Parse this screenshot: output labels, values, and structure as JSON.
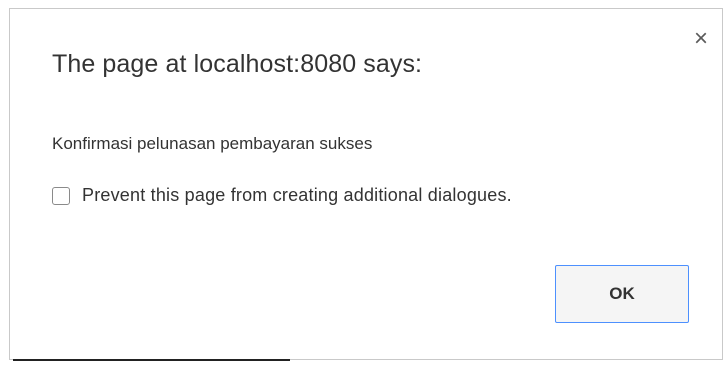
{
  "dialog": {
    "title": "The page at localhost:8080 says:",
    "close_icon": "×",
    "message": "Konfirmasi pelunasan pembayaran sukses",
    "prevent_checkbox": {
      "checked": false,
      "label": "Prevent this page from creating additional dialogues."
    },
    "ok_label": "OK"
  },
  "colors": {
    "button_border": "#4d90fe",
    "text": "#333333"
  }
}
